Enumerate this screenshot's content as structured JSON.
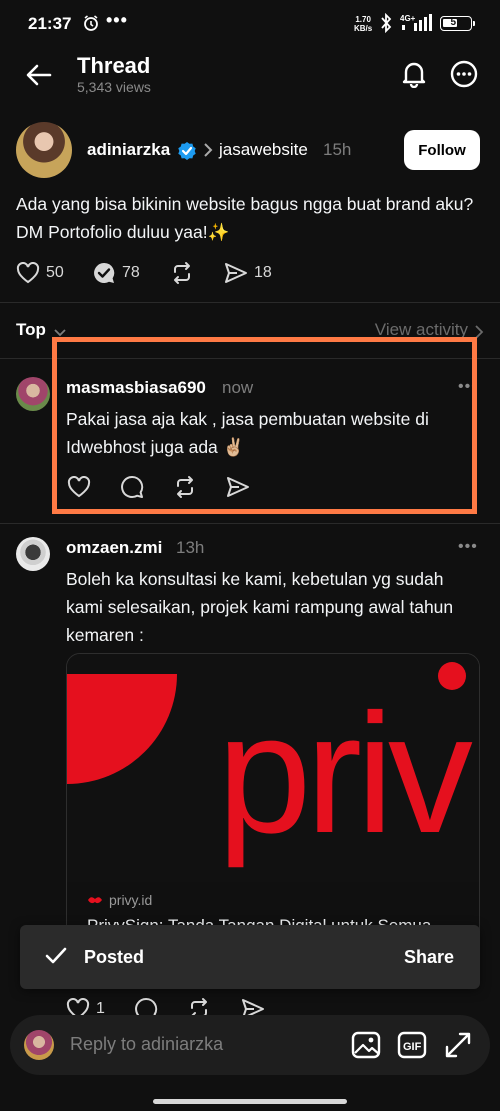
{
  "status_bar": {
    "time": "21:37",
    "speed_value": "1.70",
    "speed_unit": "KB/s",
    "network": "4G+",
    "battery": "57",
    "battery_level": 0.57
  },
  "header": {
    "title": "Thread",
    "views": "5,343 views"
  },
  "post": {
    "username": "adiniarzka",
    "reply_to": "jasawebsite",
    "time": "15h",
    "follow_label": "Follow",
    "text": "Ada yang bisa bikinin website bagus ngga buat brand aku? DM Portofolio duluu yaa!✨",
    "likes": "50",
    "replies": "78",
    "shares": "18"
  },
  "sort": {
    "label": "Top",
    "view_activity": "View activity"
  },
  "replies": [
    {
      "username": "masmasbiasa690",
      "time": "now",
      "text": "Pakai jasa aja kak , jasa pembuatan website di Idwebhost juga ada ✌🏼",
      "more": "•••"
    },
    {
      "username": "omzaen.zmi",
      "time": "13h",
      "text": "Boleh ka konsultasi ke kami, kebetulan yg sudah kami selesaikan, projek kami rampung awal tahun kemaren :",
      "more": "•••",
      "link": {
        "image_text": "priv",
        "domain": "privy.id",
        "title": "PrivySign: Tanda Tangan Digital untuk Semua Orang | Privy"
      },
      "likes": "1"
    }
  ],
  "toast": {
    "label": "Posted",
    "action": "Share"
  },
  "composer": {
    "placeholder": "Reply to adiniarzka"
  },
  "colors": {
    "background": "#101010",
    "highlight": "#ff7a45",
    "verified": "#1d9bf0",
    "privy_red": "#e5101e"
  }
}
